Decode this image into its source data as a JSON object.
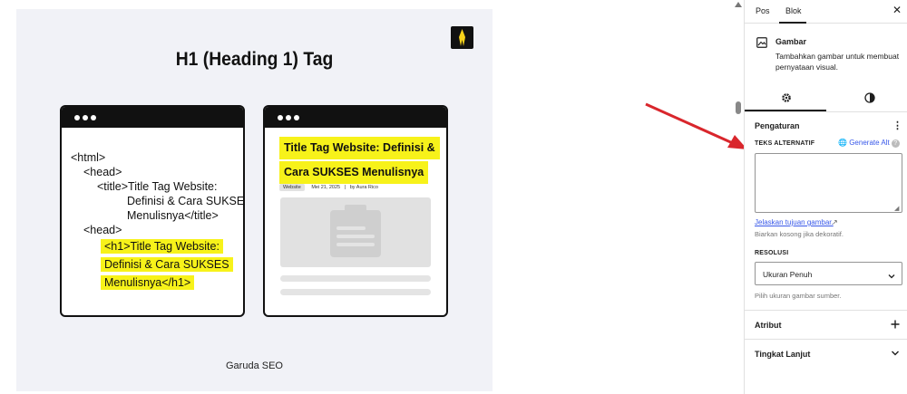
{
  "canvas": {
    "image": {
      "title": "H1 (Heading 1) Tag",
      "left_window": {
        "lines": [
          "<html>",
          "<head>",
          "<title>Title Tag Website:",
          "Definisi & Cara SUKSES",
          "Menulisnya</title>",
          "<head>"
        ],
        "highlight_lines": [
          "<h1>Title Tag Website:",
          "Definisi & Cara SUKSES",
          "Menulisnya</h1>"
        ]
      },
      "right_window": {
        "title_lines": [
          "Title Tag Website: Definisi &",
          "Cara SUKSES Menulisnya"
        ],
        "tag": "Website",
        "date": "Mei 21, 2025",
        "separator": "|",
        "author": "by Aura Rico"
      },
      "caption": "Garuda SEO"
    }
  },
  "sidebar": {
    "tabs": [
      "Pos",
      "Blok"
    ],
    "active_tab": "Blok",
    "block": {
      "name": "Gambar",
      "description": "Tambahkan gambar untuk membuat pernyataan visual.",
      "icon": "image-icon"
    },
    "settings": {
      "title": "Pengaturan",
      "alt_label": "TEKS ALTERNATIF",
      "generate_alt": "Generate Alt",
      "alt_value": "",
      "explain_link": "Jelaskan tujuan gambar.",
      "explain_help": "Biarkan kosong jika dekoratif.",
      "resolution_label": "RESOLUSI",
      "resolution_value": "Ukuran Penuh",
      "resolution_help": "Pilih ukuran gambar sumber."
    },
    "panels": [
      {
        "title": "Atribut",
        "icon": "plus-icon"
      },
      {
        "title": "Tingkat Lanjut",
        "icon": "chevron-down-icon"
      }
    ]
  },
  "colors": {
    "highlight": "#f7f21a",
    "link": "#3858e9",
    "arrow": "#d9262c",
    "canvas_bg": "#f1f2f7"
  }
}
